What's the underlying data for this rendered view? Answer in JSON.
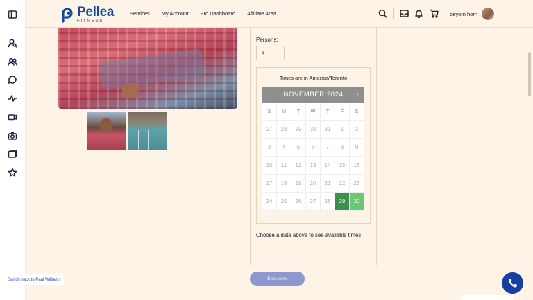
{
  "sidebar": {
    "icons": [
      "panel-toggle-icon",
      "user-search-icon",
      "users-icon",
      "chat-icon",
      "activity-icon",
      "video-icon",
      "camera-icon",
      "folder-icon",
      "star-icon"
    ]
  },
  "brand": {
    "name": "Pellea",
    "sub": "FITNESS",
    "color": "#17499a"
  },
  "nav": [
    "Services",
    "My Account",
    "Pro Dashboard",
    "Affiliate Area"
  ],
  "user": {
    "name": "beyorn horn"
  },
  "booking": {
    "persons_label": "Persons:",
    "persons_value": "1",
    "timezone": "Times are in America/Toronto",
    "calendar": {
      "prev": "‹",
      "next": "›",
      "month": "NOVEMBER 2024",
      "weekdays": [
        "S",
        "M",
        "T",
        "W",
        "T",
        "F",
        "S"
      ],
      "days": [
        "27",
        "28",
        "29",
        "30",
        "31",
        "1",
        "2",
        "3",
        "4",
        "5",
        "6",
        "7",
        "8",
        "9",
        "10",
        "11",
        "12",
        "13",
        "14",
        "15",
        "16",
        "17",
        "18",
        "19",
        "20",
        "21",
        "22",
        "23",
        "24",
        "25",
        "26",
        "27",
        "28",
        "29",
        "30"
      ],
      "available_days": [
        "29",
        "30"
      ],
      "colors": {
        "day_29": "#3e8e4e",
        "day_30": "#6bc774",
        "header": "#8f8f8f"
      }
    },
    "hint": "Choose a date above to see available times.",
    "book_label": "Book now"
  },
  "switch_back": "Switch back to Paul Williams",
  "phone_button": "phone-icon"
}
